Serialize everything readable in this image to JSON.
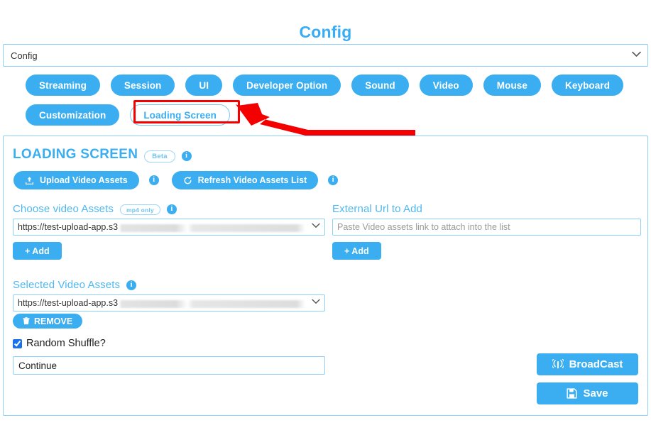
{
  "header": {
    "title": "Config"
  },
  "config_select": {
    "selected": "Config",
    "options": [
      "Config"
    ],
    "chevron_icon": "chevron-down-icon"
  },
  "tabs": [
    {
      "label": "Streaming",
      "active": false
    },
    {
      "label": "Session",
      "active": false
    },
    {
      "label": "UI",
      "active": false
    },
    {
      "label": "Developer Option",
      "active": false
    },
    {
      "label": "Sound",
      "active": false
    },
    {
      "label": "Video",
      "active": false
    },
    {
      "label": "Mouse",
      "active": false
    },
    {
      "label": "Keyboard",
      "active": false
    },
    {
      "label": "Customization",
      "active": false
    },
    {
      "label": "Loading Screen",
      "active": true
    }
  ],
  "annotation": {
    "highlight_target": "Loading Screen",
    "color": "#f40000",
    "shape": "rectangle-with-arrow"
  },
  "panel": {
    "title": "LOADING SCREEN",
    "badge": "Beta",
    "title_info_icon": "info-icon",
    "actions": [
      {
        "label": "Upload Video Assets",
        "icon": "upload-icon",
        "info_icon": "info-icon"
      },
      {
        "label": "Refresh Video Assets List",
        "icon": "refresh-icon",
        "info_icon": "info-icon"
      }
    ],
    "choose_video_assets": {
      "label": "Choose video Assets",
      "badge": "mp4 only",
      "info_icon": "info-icon",
      "selected_value": "https://test-upload-app.s3",
      "value_redacted": true,
      "chevron_icon": "chevron-down-icon",
      "add_label": "+  Add"
    },
    "external_url": {
      "label": "External Url to Add",
      "value": "",
      "placeholder": "Paste Video assets link to attach into the list",
      "add_label": "+  Add"
    },
    "selected_video_assets": {
      "label": "Selected Video Assets",
      "info_icon": "info-icon",
      "selected_value": "https://test-upload-app.s3",
      "value_redacted": true,
      "chevron_icon": "chevron-down-icon",
      "remove_label": "REMOVE",
      "remove_icon": "trash-icon"
    },
    "random_shuffle": {
      "label": "Random Shuffle?",
      "checked": true
    },
    "continue_field": {
      "value": "Continue",
      "placeholder": ""
    },
    "footer_buttons": [
      {
        "label": "BroadCast",
        "icon": "broadcast-icon"
      },
      {
        "label": "Save",
        "icon": "save-floppy-icon"
      }
    ]
  },
  "colors": {
    "accent": "#3aaef0",
    "accent_light": "#8ed0f5",
    "annotation_red": "#f40000",
    "text_dark": "#333333"
  }
}
